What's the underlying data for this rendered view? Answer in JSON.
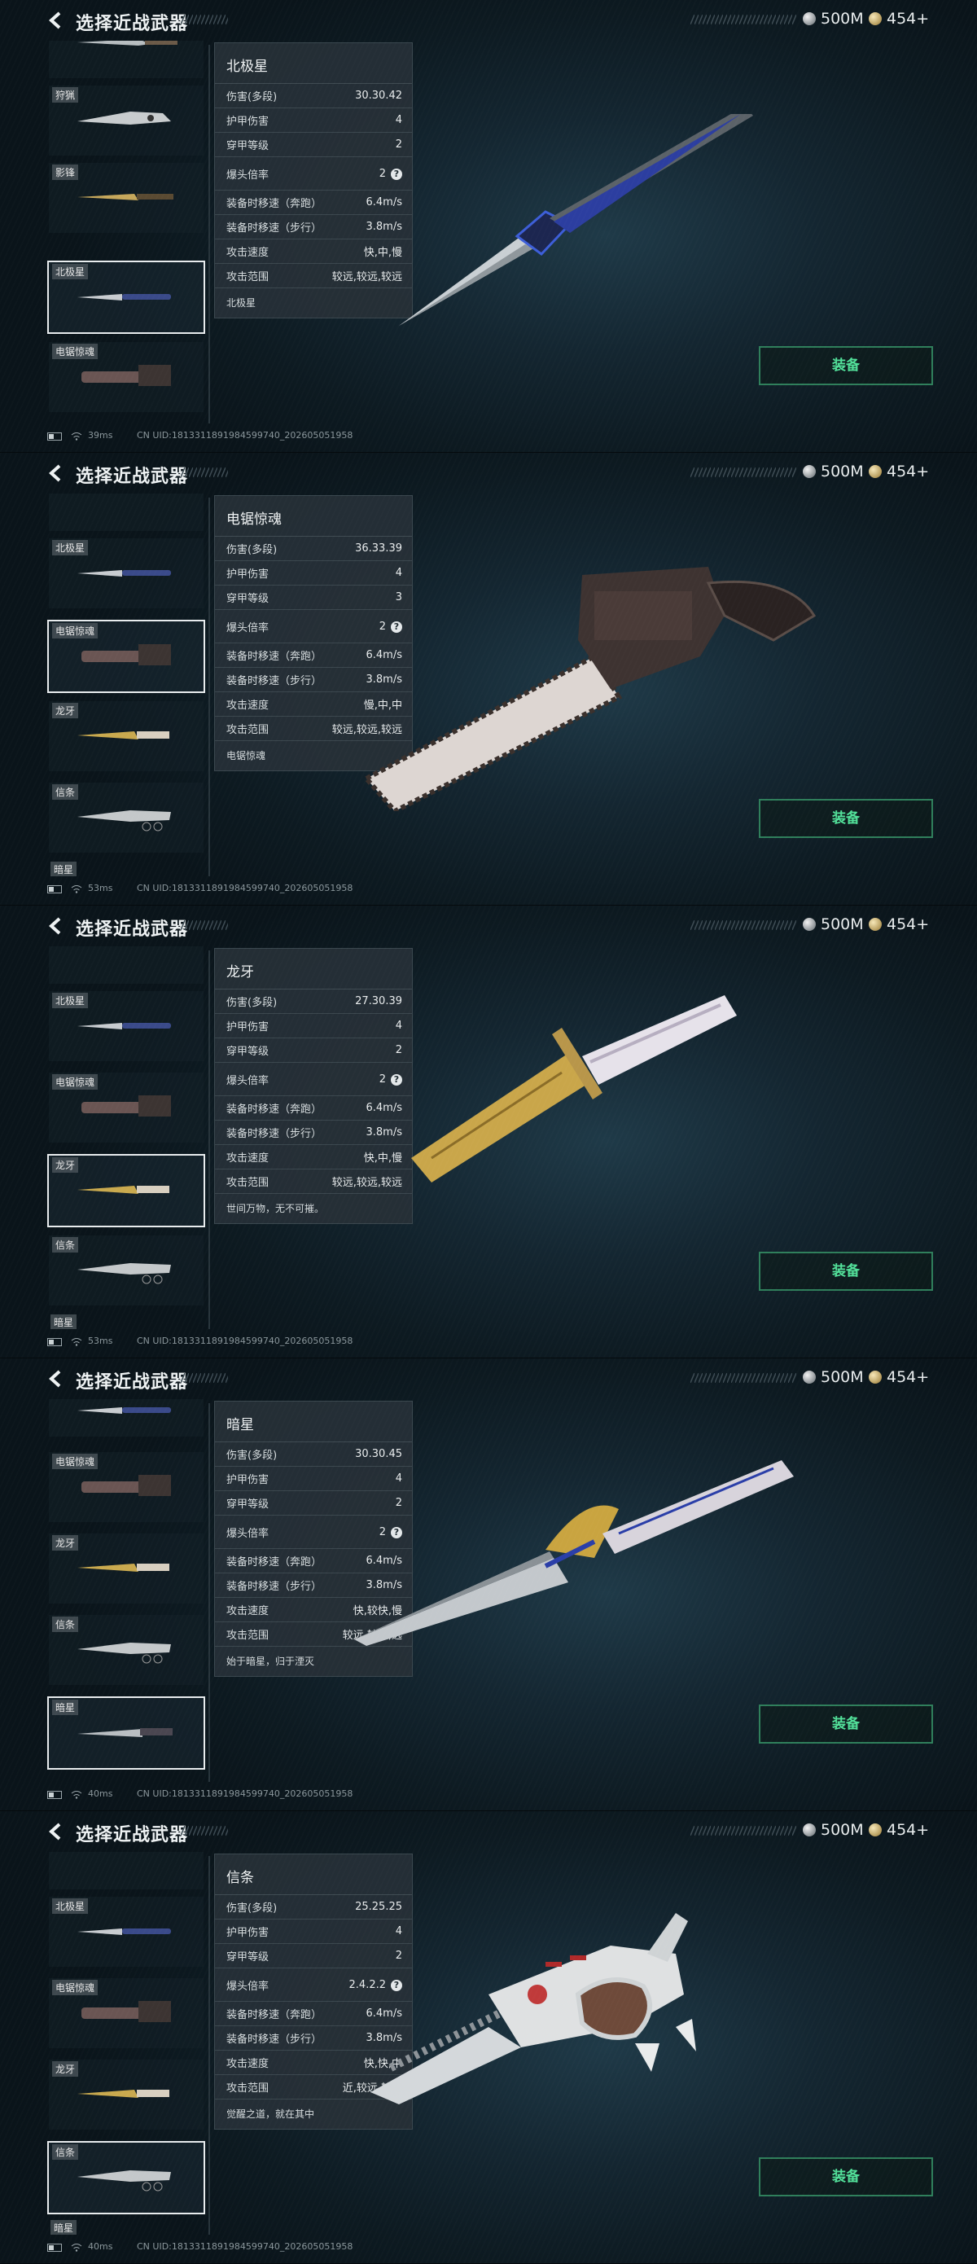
{
  "header": {
    "title": "选择近战武器",
    "currency_silver": "500M",
    "currency_gold": "454+",
    "back_icon": "chevron-left-icon"
  },
  "equip_label": "装备",
  "uid": "CN UID:1813311891984599740_202605051958",
  "colors": {
    "accent_green": "#52e19a",
    "equip_border": "#2f7f5b",
    "panel_bg": "#0b151b"
  },
  "stat_labels": {
    "damage": "伤害(多段)",
    "armor_damage": "护甲伤害",
    "penetration": "穿甲等级",
    "headshot": "爆头倍率",
    "run_speed": "装备时移速（奔跑）",
    "walk_speed": "装备时移速（步行）",
    "attack_speed": "攻击速度",
    "attack_range": "攻击范围"
  },
  "screens": [
    {
      "ping": "39ms",
      "list_items": [
        {
          "label": "",
          "selected": false
        },
        {
          "label": "狩猟",
          "selected": false
        },
        {
          "label": "影锋",
          "selected": false
        },
        {
          "label": "北极星",
          "selected": true
        },
        {
          "label": "电锯惊魂",
          "selected": false
        }
      ],
      "stats": {
        "name": "北极星",
        "damage": "30.30.42",
        "armor_damage": "4",
        "penetration": "2",
        "headshot": "2",
        "run_speed": "6.4m/s",
        "walk_speed": "3.8m/s",
        "attack_speed": "快,中,慢",
        "attack_range": "较远,较远,较远",
        "description": "北极星"
      }
    },
    {
      "ping": "53ms",
      "list_items": [
        {
          "label": "",
          "selected": false
        },
        {
          "label": "北极星",
          "selected": false
        },
        {
          "label": "电锯惊魂",
          "selected": true
        },
        {
          "label": "龙牙",
          "selected": false
        },
        {
          "label": "信条",
          "selected": false
        },
        {
          "label": "暗星",
          "selected": false
        }
      ],
      "stats": {
        "name": "电锯惊魂",
        "damage": "36.33.39",
        "armor_damage": "4",
        "penetration": "3",
        "headshot": "2",
        "run_speed": "6.4m/s",
        "walk_speed": "3.8m/s",
        "attack_speed": "慢,中,中",
        "attack_range": "较远,较远,较远",
        "description": "电锯惊魂"
      }
    },
    {
      "ping": "53ms",
      "list_items": [
        {
          "label": "",
          "selected": false
        },
        {
          "label": "北极星",
          "selected": false
        },
        {
          "label": "电锯惊魂",
          "selected": false
        },
        {
          "label": "龙牙",
          "selected": true
        },
        {
          "label": "信条",
          "selected": false
        },
        {
          "label": "暗星",
          "selected": false
        }
      ],
      "stats": {
        "name": "龙牙",
        "damage": "27.30.39",
        "armor_damage": "4",
        "penetration": "2",
        "headshot": "2",
        "run_speed": "6.4m/s",
        "walk_speed": "3.8m/s",
        "attack_speed": "快,中,慢",
        "attack_range": "较远,较远,较远",
        "description": "世间万物，无不可摧。"
      }
    },
    {
      "ping": "40ms",
      "list_items": [
        {
          "label": "",
          "selected": false
        },
        {
          "label": "电锯惊魂",
          "selected": false
        },
        {
          "label": "龙牙",
          "selected": false
        },
        {
          "label": "信条",
          "selected": false
        },
        {
          "label": "暗星",
          "selected": true
        }
      ],
      "stats": {
        "name": "暗星",
        "damage": "30.30.45",
        "armor_damage": "4",
        "penetration": "2",
        "headshot": "2",
        "run_speed": "6.4m/s",
        "walk_speed": "3.8m/s",
        "attack_speed": "快,较快,慢",
        "attack_range": "较远,较远,远",
        "description": "始于暗星，归于湮灭"
      }
    },
    {
      "ping": "40ms",
      "list_items": [
        {
          "label": "",
          "selected": false
        },
        {
          "label": "北极星",
          "selected": false
        },
        {
          "label": "电锯惊魂",
          "selected": false
        },
        {
          "label": "龙牙",
          "selected": false
        },
        {
          "label": "信条",
          "selected": true
        },
        {
          "label": "暗星",
          "selected": false
        }
      ],
      "stats": {
        "name": "信条",
        "damage": "25.25.25",
        "armor_damage": "4",
        "penetration": "2",
        "headshot": "2.4.2.2",
        "run_speed": "6.4m/s",
        "walk_speed": "3.8m/s",
        "attack_speed": "快,快,中",
        "attack_range": "近,较远,较远",
        "description": "觉醒之道，就在其中"
      }
    }
  ]
}
